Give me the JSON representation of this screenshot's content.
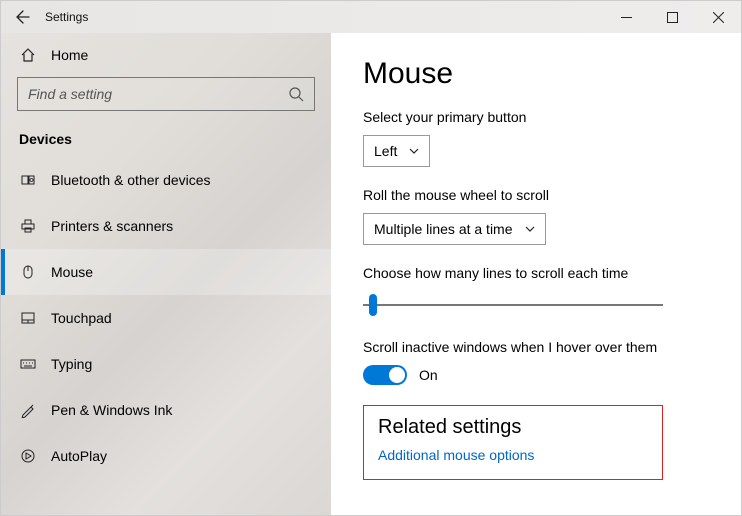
{
  "titlebar": {
    "title": "Settings"
  },
  "sidebar": {
    "home_label": "Home",
    "search_placeholder": "Find a setting",
    "category": "Devices",
    "items": [
      {
        "label": "Bluetooth & other devices"
      },
      {
        "label": "Printers & scanners"
      },
      {
        "label": "Mouse"
      },
      {
        "label": "Touchpad"
      },
      {
        "label": "Typing"
      },
      {
        "label": "Pen & Windows Ink"
      },
      {
        "label": "AutoPlay"
      }
    ],
    "active_index": 2
  },
  "content": {
    "heading": "Mouse",
    "primary_button": {
      "label": "Select your primary button",
      "value": "Left"
    },
    "wheel": {
      "label": "Roll the mouse wheel to scroll",
      "value": "Multiple lines at a time"
    },
    "lines": {
      "label": "Choose how many lines to scroll each time"
    },
    "hover": {
      "label": "Scroll inactive windows when I hover over them",
      "value": "On"
    },
    "related": {
      "heading": "Related settings",
      "link": "Additional mouse options"
    }
  }
}
